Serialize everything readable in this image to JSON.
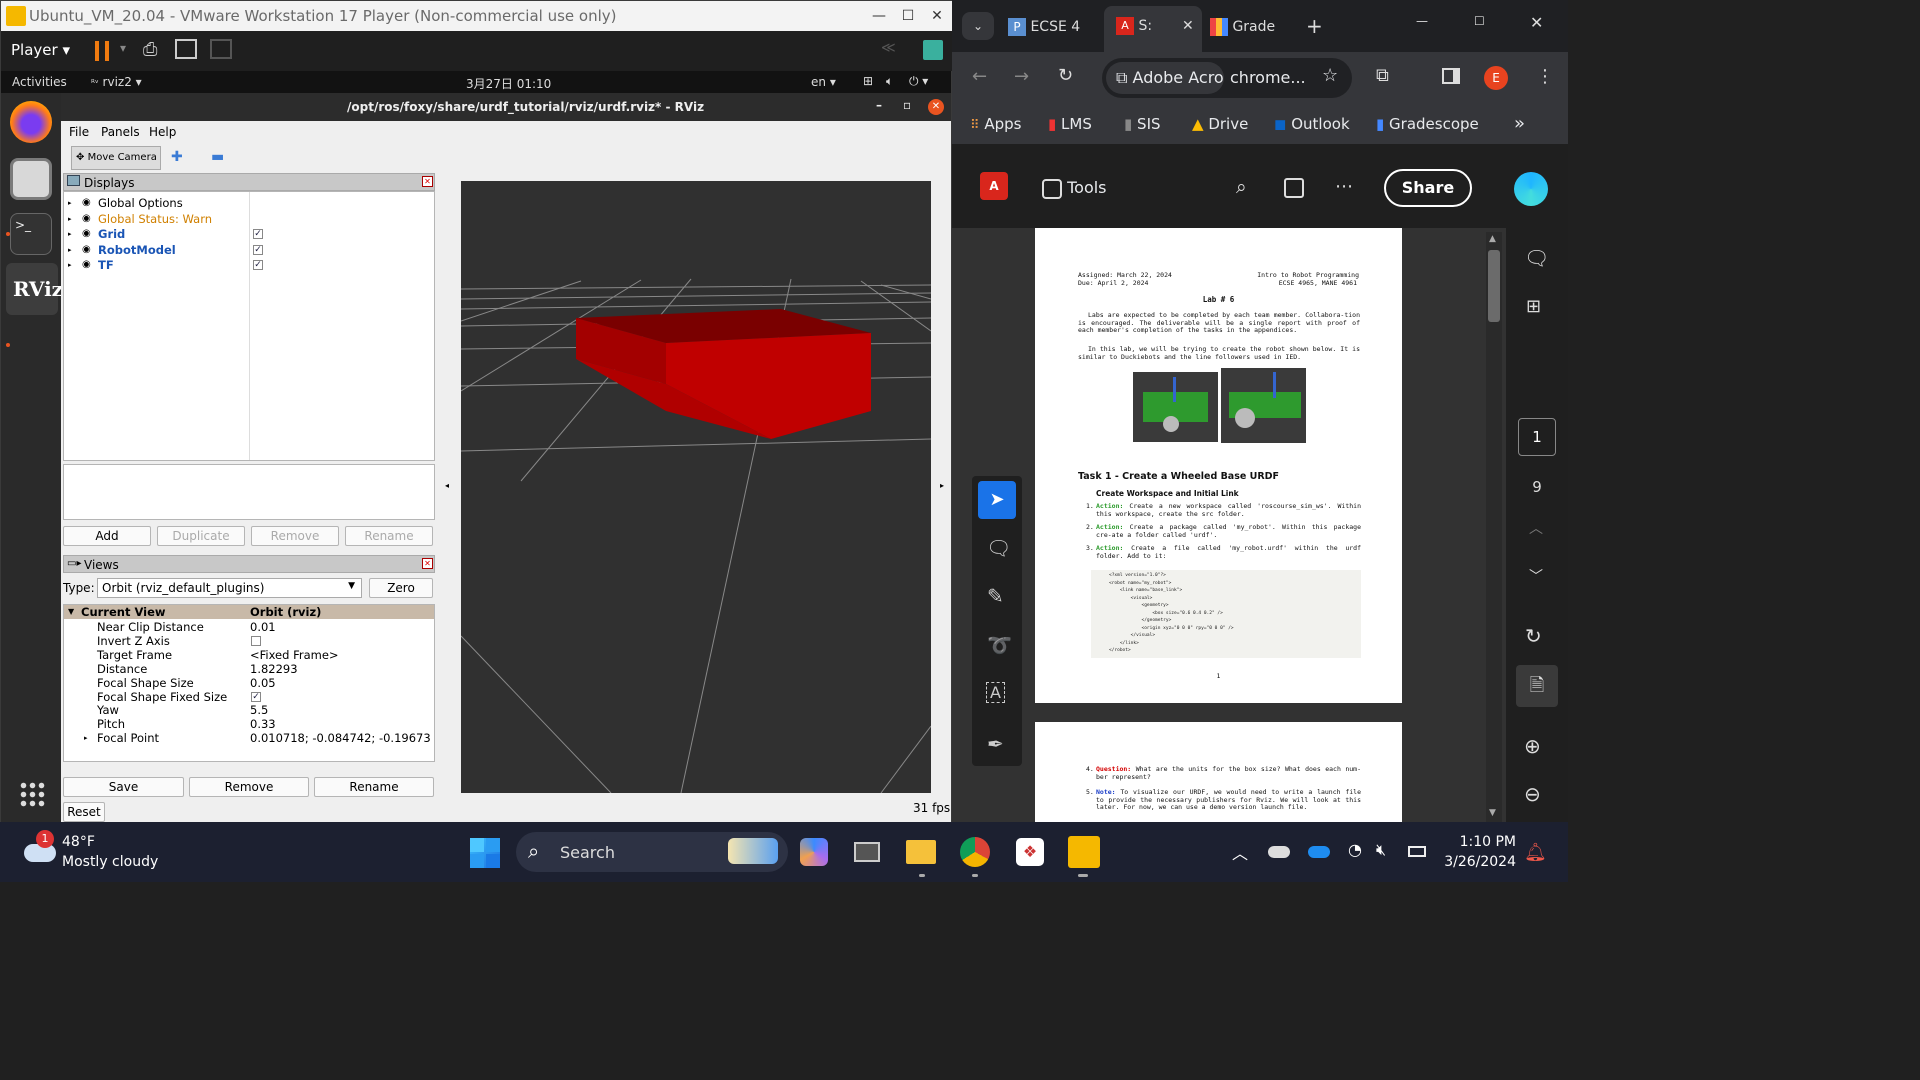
{
  "vmware": {
    "title": "Ubuntu_VM_20.04 - VMware Workstation 17 Player (Non-commercial use only)",
    "player_label": "Player"
  },
  "ubuntu": {
    "activities": "Activities",
    "app_name": "rviz2",
    "clock": "3月27日  01:10",
    "lang": "en"
  },
  "rviz": {
    "title": "/opt/ros/foxy/share/urdf_tutorial/rviz/urdf.rviz* - RViz",
    "menu": [
      "File",
      "Panels",
      "Help"
    ],
    "tool_move_camera": "Move Camera",
    "displays_header": "Displays",
    "displays": [
      {
        "label": "Global Options",
        "color": "#000000",
        "checked": false
      },
      {
        "label": "Global Status: Warn",
        "color": "#d08000",
        "checked": false
      },
      {
        "label": "Grid",
        "color": "#1a55b5",
        "checked": true
      },
      {
        "label": "RobotModel",
        "color": "#1a55b5",
        "checked": true
      },
      {
        "label": "TF",
        "color": "#1a55b5",
        "checked": true
      }
    ],
    "display_buttons": [
      "Add",
      "Duplicate",
      "Remove",
      "Rename"
    ],
    "views_header": "Views",
    "type_label": "Type:",
    "type_value": "Orbit (rviz_default_plugins)",
    "zero_label": "Zero",
    "current_view_label": "Current View",
    "current_view_value": "Orbit (rviz)",
    "view_props": [
      {
        "name": "Near Clip Distance",
        "value": "0.01"
      },
      {
        "name": "Invert Z Axis",
        "value": "",
        "checkbox": "unchecked"
      },
      {
        "name": "Target Frame",
        "value": "<Fixed Frame>"
      },
      {
        "name": "Distance",
        "value": "1.82293"
      },
      {
        "name": "Focal Shape Size",
        "value": "0.05"
      },
      {
        "name": "Focal Shape Fixed Size",
        "value": "",
        "checkbox": "checked"
      },
      {
        "name": "Yaw",
        "value": "5.5"
      },
      {
        "name": "Pitch",
        "value": "0.33"
      },
      {
        "name": "Focal Point",
        "value": "0.010718; -0.084742; -0.19673"
      }
    ],
    "view_buttons": [
      "Save",
      "Remove",
      "Rename"
    ],
    "reset_label": "Reset",
    "fps": "31 fps",
    "box_color": "#b00000"
  },
  "chrome": {
    "tabs": [
      {
        "label": "ECSE 4",
        "active": false
      },
      {
        "label": "S:",
        "active": true
      },
      {
        "label": "Grade",
        "active": false
      }
    ],
    "profile_initial": "E",
    "address_site": "Adobe Acro",
    "address_url": "chrome...",
    "bookmarks": [
      "Apps",
      "LMS",
      "SIS",
      "Drive",
      "Outlook",
      "Gradescope"
    ]
  },
  "acrobat": {
    "tools_label": "Tools",
    "share_label": "Share",
    "page_current": "1",
    "page_total": "9"
  },
  "pdf": {
    "assigned": "Assigned: March 22, 2024",
    "due": "Due: April 2, 2024",
    "course": "Intro to Robot Programming",
    "course_codes": "ECSE 4965, MANE 4961",
    "lab_title": "Lab # 6",
    "para1": "Labs are expected to be completed by each team member. Collabora-tion is encouraged. The deliverable will be a single report with proof of each member's completion of the tasks in the appendices.",
    "para2": "In this lab, we will be trying to create the robot shown below. It is similar to Duckiebots and the line followers used in IED.",
    "task_title": "Task 1 - Create a Wheeled Base URDF",
    "subtitle": "Create Workspace and Initial Link",
    "items": [
      {
        "n": "1.",
        "tag": "Action:",
        "text": "Create a new workspace called 'roscourse_sim_ws'. Within this workspace, create the src folder."
      },
      {
        "n": "2.",
        "tag": "Action:",
        "text": "Create a package called 'my_robot'. Within this package cre-ate a folder called 'urdf'."
      },
      {
        "n": "3.",
        "tag": "Action:",
        "text": "Create a file called 'my_robot.urdf' within the urdf folder. Add to it:"
      }
    ],
    "code": [
      "<?xml version=\"1.0\"?>",
      "<robot name=\"my_robot\">",
      "    <link name=\"base_link\">",
      "        <visual>",
      "            <geometry>",
      "                <box size=\"0.6 0.4 0.2\" />",
      "            </geometry>",
      "            <origin xyz=\"0 0 0\" rpy=\"0 0 0\" />",
      "        </visual>",
      "    </link>",
      "</robot>"
    ],
    "page_number": "1",
    "items2": [
      {
        "n": "4.",
        "tag": "Question:",
        "text": "What are the units for the box size? What does each num-ber represent?"
      },
      {
        "n": "5.",
        "tag": "Note:",
        "text": "To visualize our URDF, we would need to write a launch file to provide the necessary publishers for Rviz. We will look at this later. For now, we can use a demo version launch file."
      }
    ]
  },
  "taskbar": {
    "weather_temp": "48°F",
    "weather_desc": "Mostly cloudy",
    "weather_badge": "1",
    "search_label": "Search",
    "time": "1:10 PM",
    "date": "3/26/2024"
  }
}
